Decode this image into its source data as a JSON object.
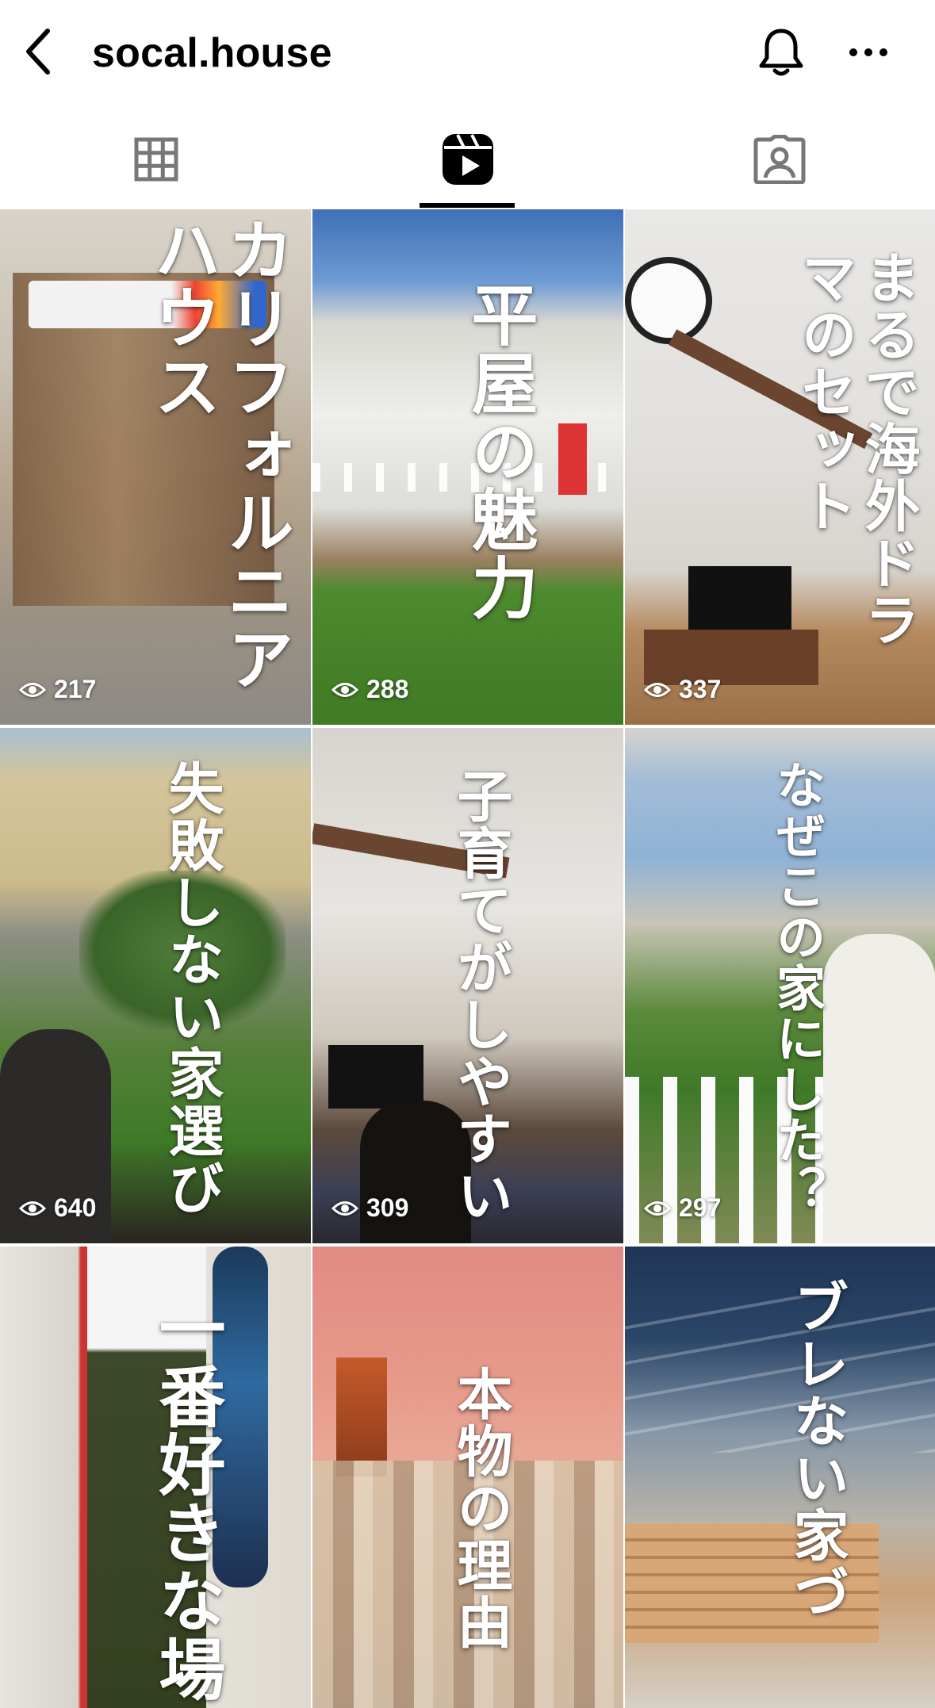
{
  "header": {
    "title": "socal.house",
    "back_icon": "chevron-left-icon",
    "bell_icon": "bell-icon",
    "more_icon": "more-horizontal-icon"
  },
  "tabs": [
    {
      "name": "grid",
      "icon": "grid-icon",
      "active": false
    },
    {
      "name": "reels",
      "icon": "reels-icon",
      "active": true
    },
    {
      "name": "tagged",
      "icon": "tagged-icon",
      "active": false
    }
  ],
  "reels": [
    {
      "caption": "カリフォルニアハウス",
      "views": "217"
    },
    {
      "caption": "平屋の魅力",
      "views": "288"
    },
    {
      "caption": "まるで海外ドラマのセット",
      "views": "337"
    },
    {
      "caption": "失敗しない家選び",
      "views": "640"
    },
    {
      "caption": "子育てがしやすい",
      "views": "309"
    },
    {
      "caption": "なぜこの家にした？",
      "views": "297"
    },
    {
      "caption": "一番好きな場",
      "views": ""
    },
    {
      "caption": "本物の理由",
      "views": ""
    },
    {
      "caption": "ブレない家づ",
      "views": ""
    }
  ]
}
